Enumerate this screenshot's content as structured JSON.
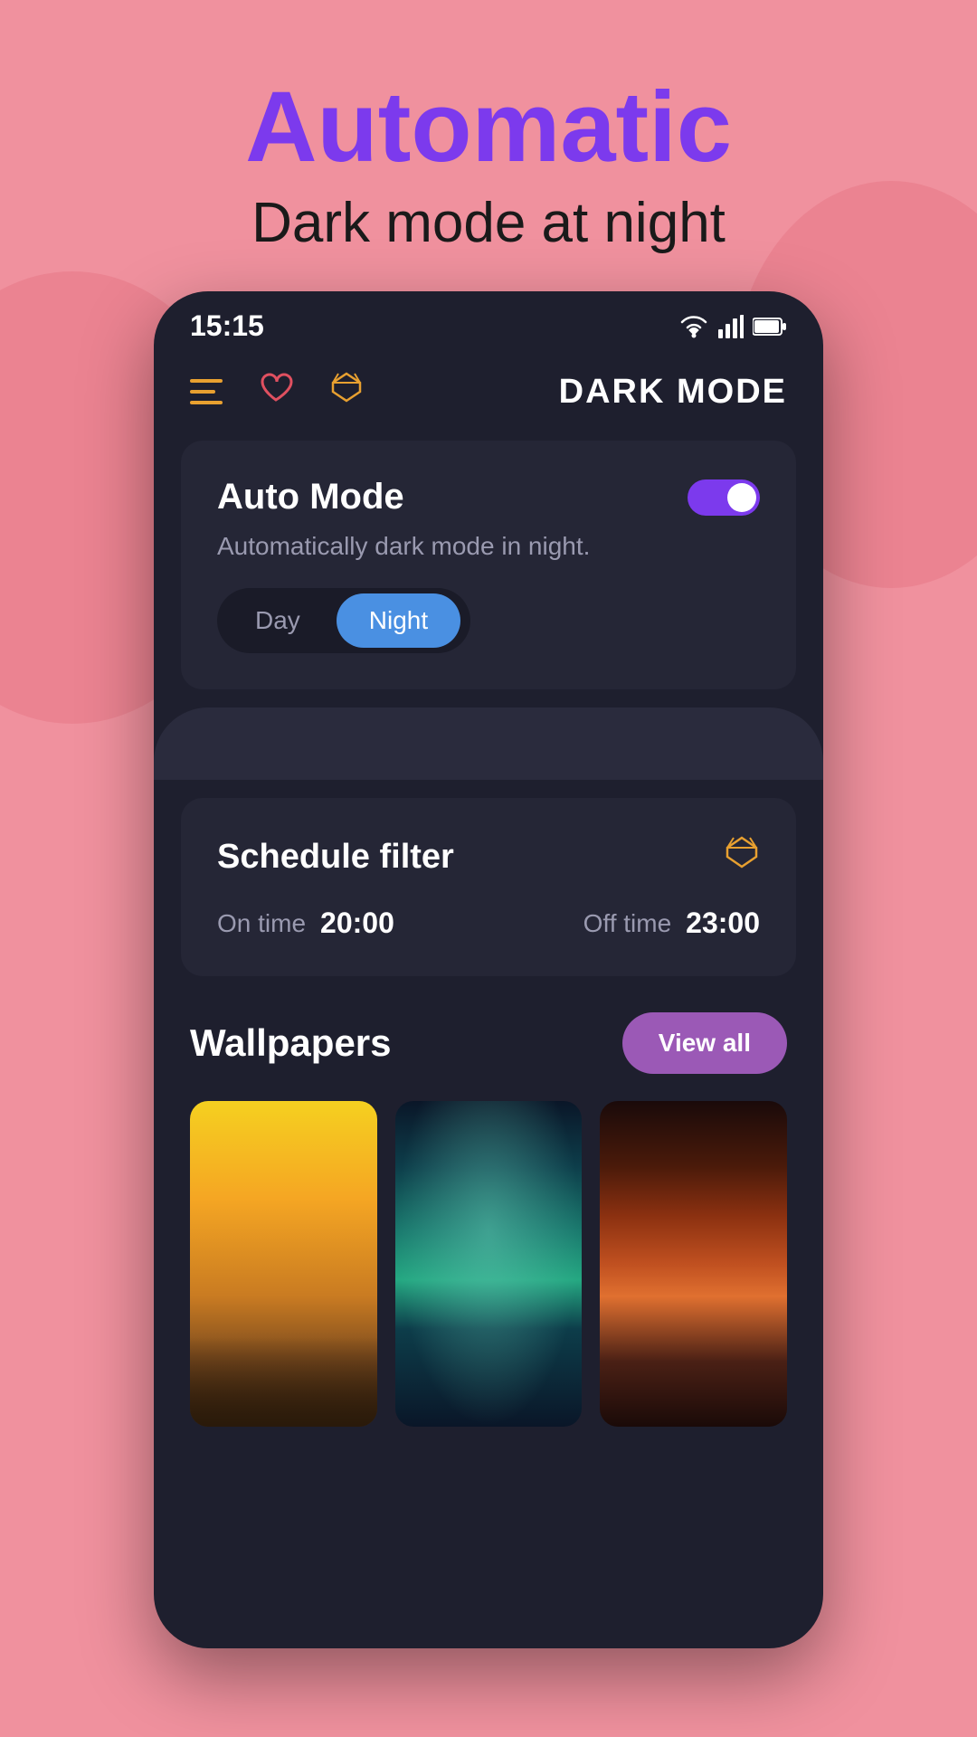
{
  "header": {
    "title": "Automatic",
    "subtitle": "Dark mode at night"
  },
  "statusBar": {
    "time": "15:15",
    "wifiIcon": "wifi-icon",
    "signalIcon": "signal-icon",
    "batteryIcon": "battery-icon"
  },
  "nav": {
    "menuIcon": "menu-icon",
    "heartIcon": "heart-icon",
    "diamondIcon": "diamond-icon",
    "title": "DARK MODE"
  },
  "autoMode": {
    "title": "Auto Mode",
    "description": "Automatically dark mode in night.",
    "toggleEnabled": true,
    "dayLabel": "Day",
    "nightLabel": "Night",
    "activeTab": "Night"
  },
  "scheduleFilter": {
    "title": "Schedule filter",
    "onTimeLabel": "On time",
    "onTimeValue": "20:00",
    "offTimeLabel": "Off time",
    "offTimeValue": "23:00"
  },
  "wallpapers": {
    "title": "Wallpapers",
    "viewAllLabel": "View all"
  }
}
